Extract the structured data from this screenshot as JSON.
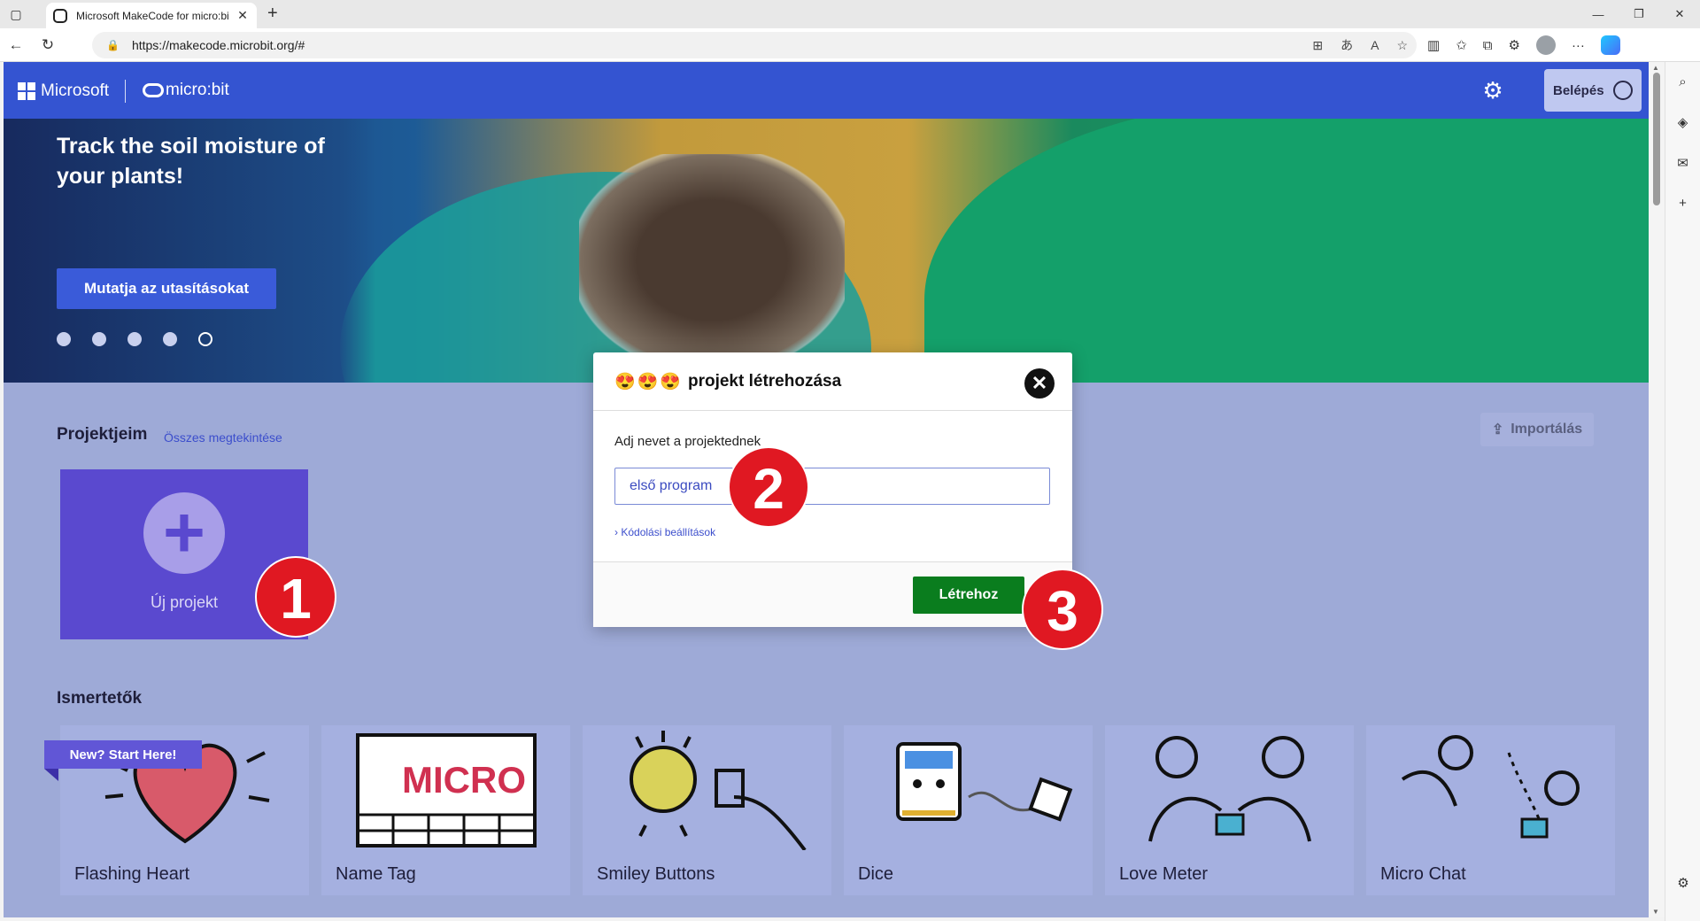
{
  "browser": {
    "tab_title": "Microsoft MakeCode for micro:bi",
    "url": "https://makecode.microbit.org/#",
    "new_tab": "+",
    "close_tab": "✕"
  },
  "header": {
    "microsoft": "Microsoft",
    "microbit": "micro:bit",
    "login": "Belépés"
  },
  "hero": {
    "title": "Track the soil moisture of your plants!",
    "button": "Mutatja az utasításokat",
    "dots": 5,
    "active_dot": 5
  },
  "projects": {
    "title": "Projektjeim",
    "view_all": "Összes megtekintése",
    "import": "Importálás",
    "new_project": "Új projekt"
  },
  "tutorials": {
    "title": "Ismertetők",
    "ribbon": "New? Start Here!",
    "cards": [
      {
        "label": "Flashing Heart",
        "icon": "heart-icon"
      },
      {
        "label": "Name Tag",
        "icon": "name-tag-icon"
      },
      {
        "label": "Smiley Buttons",
        "icon": "smiley-icon"
      },
      {
        "label": "Dice",
        "icon": "dice-icon"
      },
      {
        "label": "Love Meter",
        "icon": "love-meter-icon"
      },
      {
        "label": "Micro Chat",
        "icon": "chat-icon"
      }
    ]
  },
  "dialog": {
    "emojis": "😍😍😍",
    "title": "projekt létrehozása",
    "label": "Adj nevet a projektednek",
    "input_value": "első program",
    "options": "Kódolási beállítások",
    "create": "Létrehoz"
  },
  "markers": [
    "1",
    "2",
    "3"
  ],
  "colors": {
    "header": "#3454d1",
    "create_button": "#0a7d1e",
    "marker": "#e01822",
    "new_project": "#5a49cf"
  }
}
